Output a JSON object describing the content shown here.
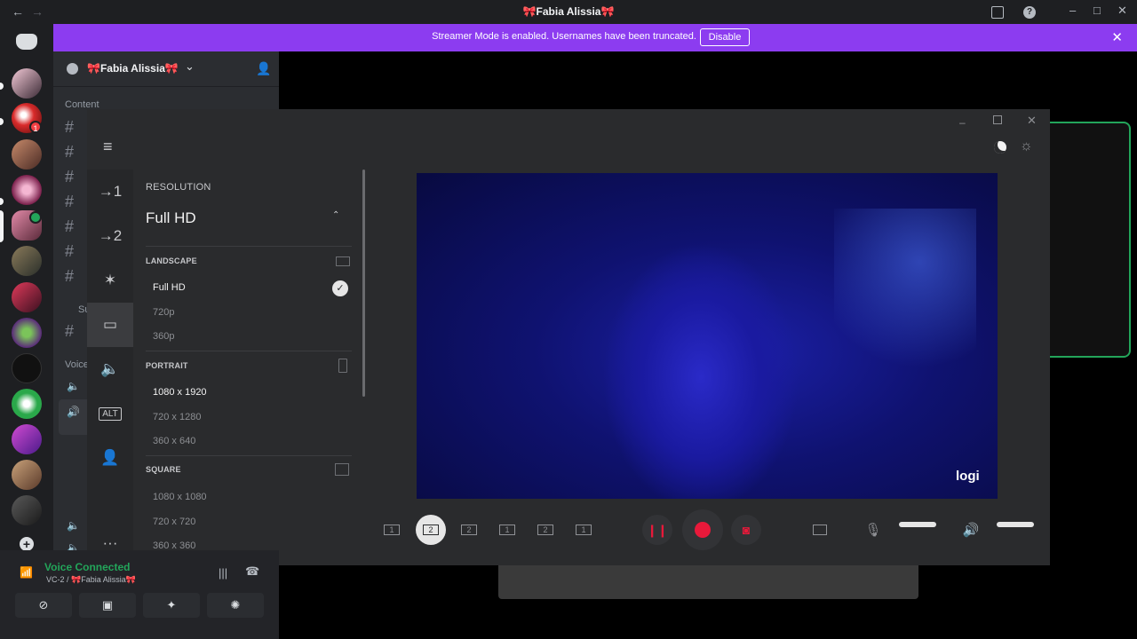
{
  "titlebar": {
    "title": "🎀Fabia Alissia🎀",
    "back": "←",
    "forward": "→",
    "minimize": "–",
    "maximize": "□",
    "close": "✕"
  },
  "banner": {
    "text": "Streamer Mode is enabled. Usernames have been truncated.",
    "button": "Disable",
    "close": "✕"
  },
  "rail": {
    "discord_logo": "discord-icon",
    "add_server": "+",
    "badge_count": "1"
  },
  "guild": {
    "name": "🎀Fabia Alissia🎀",
    "chevron": "⌄",
    "category": "Content",
    "suffix_category": "Su",
    "voice_category": "Voice"
  },
  "voice": {
    "status": "Voice Connected",
    "channel": "VC-2 / ",
    "server": "🎀Fabia Alissia🎀"
  },
  "logi": {
    "section_resolution": "RESOLUTION",
    "current": "Full HD",
    "landscape": {
      "label": "LANDSCAPE",
      "options": [
        "Full HD",
        "720p",
        "360p"
      ]
    },
    "portrait": {
      "label": "PORTRAIT",
      "options": [
        "1080 x 1920",
        "720 x 1280",
        "360 x 640"
      ]
    },
    "square": {
      "label": "SQUARE",
      "options": [
        "1080 x 1080",
        "720 x 720",
        "360 x 360"
      ]
    },
    "iconbar": [
      "→1",
      "→2",
      "✶",
      "▭",
      "🔈",
      "ALT",
      "👤",
      "···"
    ],
    "watermark": "logi",
    "layouts": [
      "1",
      "2",
      "2",
      "1",
      "2",
      "1"
    ],
    "hamburger": "≡"
  },
  "colors": {
    "accent_purple": "#8c3cf0",
    "record_red": "#e8193a",
    "online_green": "#23a55a"
  }
}
